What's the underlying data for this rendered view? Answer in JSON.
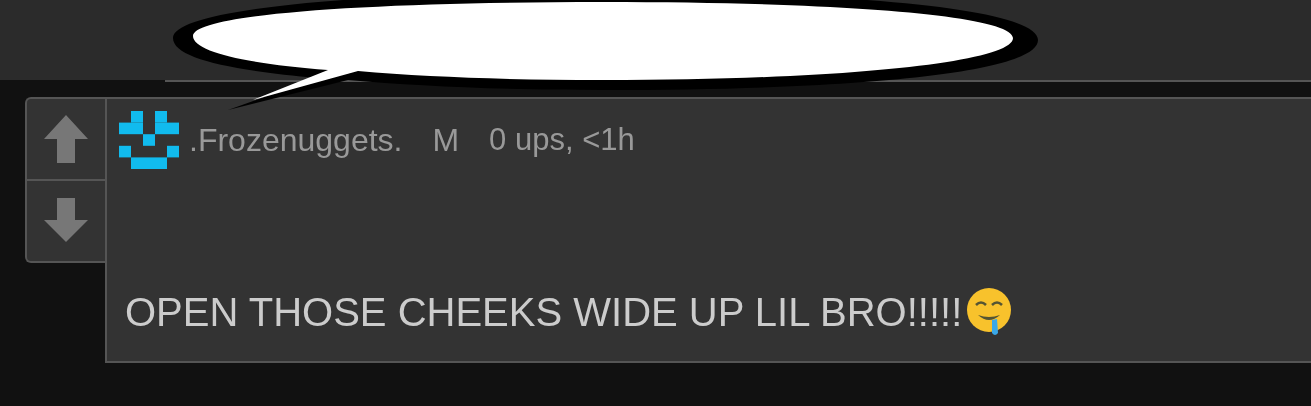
{
  "comment": {
    "username": ".Frozenuggets.",
    "gender": "M",
    "meta": "0 ups, <1h",
    "text": "OPEN THOSE CHEEKS WIDE UP LIL BRO!!!!!"
  }
}
